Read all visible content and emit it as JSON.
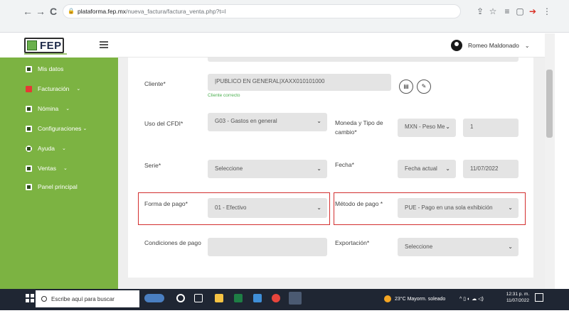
{
  "browser": {
    "back_icon": "←",
    "forward_icon": "→",
    "reload_icon": "C",
    "url_host": "plataforma.fep.mx",
    "url_path": "/nueva_factura/factura_venta.php?t=l"
  },
  "header": {
    "logo_text": "FEP",
    "user_name": "Romeo Maldonado",
    "user_chevron": "⌄"
  },
  "sidebar": {
    "items": [
      {
        "label": "Mis datos",
        "icon": "user-card-icon",
        "has_chevron": false
      },
      {
        "label": "Facturación",
        "icon": "invoice-icon",
        "has_chevron": true
      },
      {
        "label": "Nómina",
        "icon": "payroll-icon",
        "has_chevron": true
      },
      {
        "label": "Configuraciones",
        "icon": "settings-icon",
        "has_chevron": true
      },
      {
        "label": "Ayuda",
        "icon": "help-icon",
        "has_chevron": true
      },
      {
        "label": "Ventas",
        "icon": "sales-icon",
        "has_chevron": true
      },
      {
        "label": "Panel principal",
        "icon": "panel-icon",
        "has_chevron": false
      }
    ],
    "chevron": "⌄"
  },
  "form": {
    "cliente": {
      "label": "Cliente*",
      "value": "|PUBLICO EN GENERAL|XAXX010101000",
      "help": "Cliente correcto"
    },
    "uso_cfdi": {
      "label": "Uso del CFDI*",
      "value": "G03 - Gastos en general"
    },
    "moneda": {
      "label": "Moneda y Tipo de cambio*",
      "value": "MXN - Peso Me",
      "rate": "1"
    },
    "serie": {
      "label": "Serie*",
      "value": "Seleccione"
    },
    "fecha": {
      "label": "Fecha*",
      "mode": "Fecha actual",
      "value": "11/07/2022"
    },
    "forma_pago": {
      "label": "Forma de pago*",
      "value": "01 - Efectivo"
    },
    "metodo_pago": {
      "label": "Método de pago *",
      "value": "PUE - Pago en una sola exhibición"
    },
    "condiciones": {
      "label": "Condiciones de pago",
      "value": ""
    },
    "exportacion": {
      "label": "Exportación*",
      "value": "Seleccione"
    },
    "caret": "⌄"
  },
  "taskbar": {
    "search_placeholder": "Escribe aquí para buscar",
    "weather": "23°C  Mayorm. soleado",
    "time": "12:31 p. m.",
    "date": "11/07/2022"
  },
  "colors": {
    "sidebar_green": "#7cb342",
    "highlight_red": "#d32f2f",
    "help_green": "#4caf50"
  }
}
